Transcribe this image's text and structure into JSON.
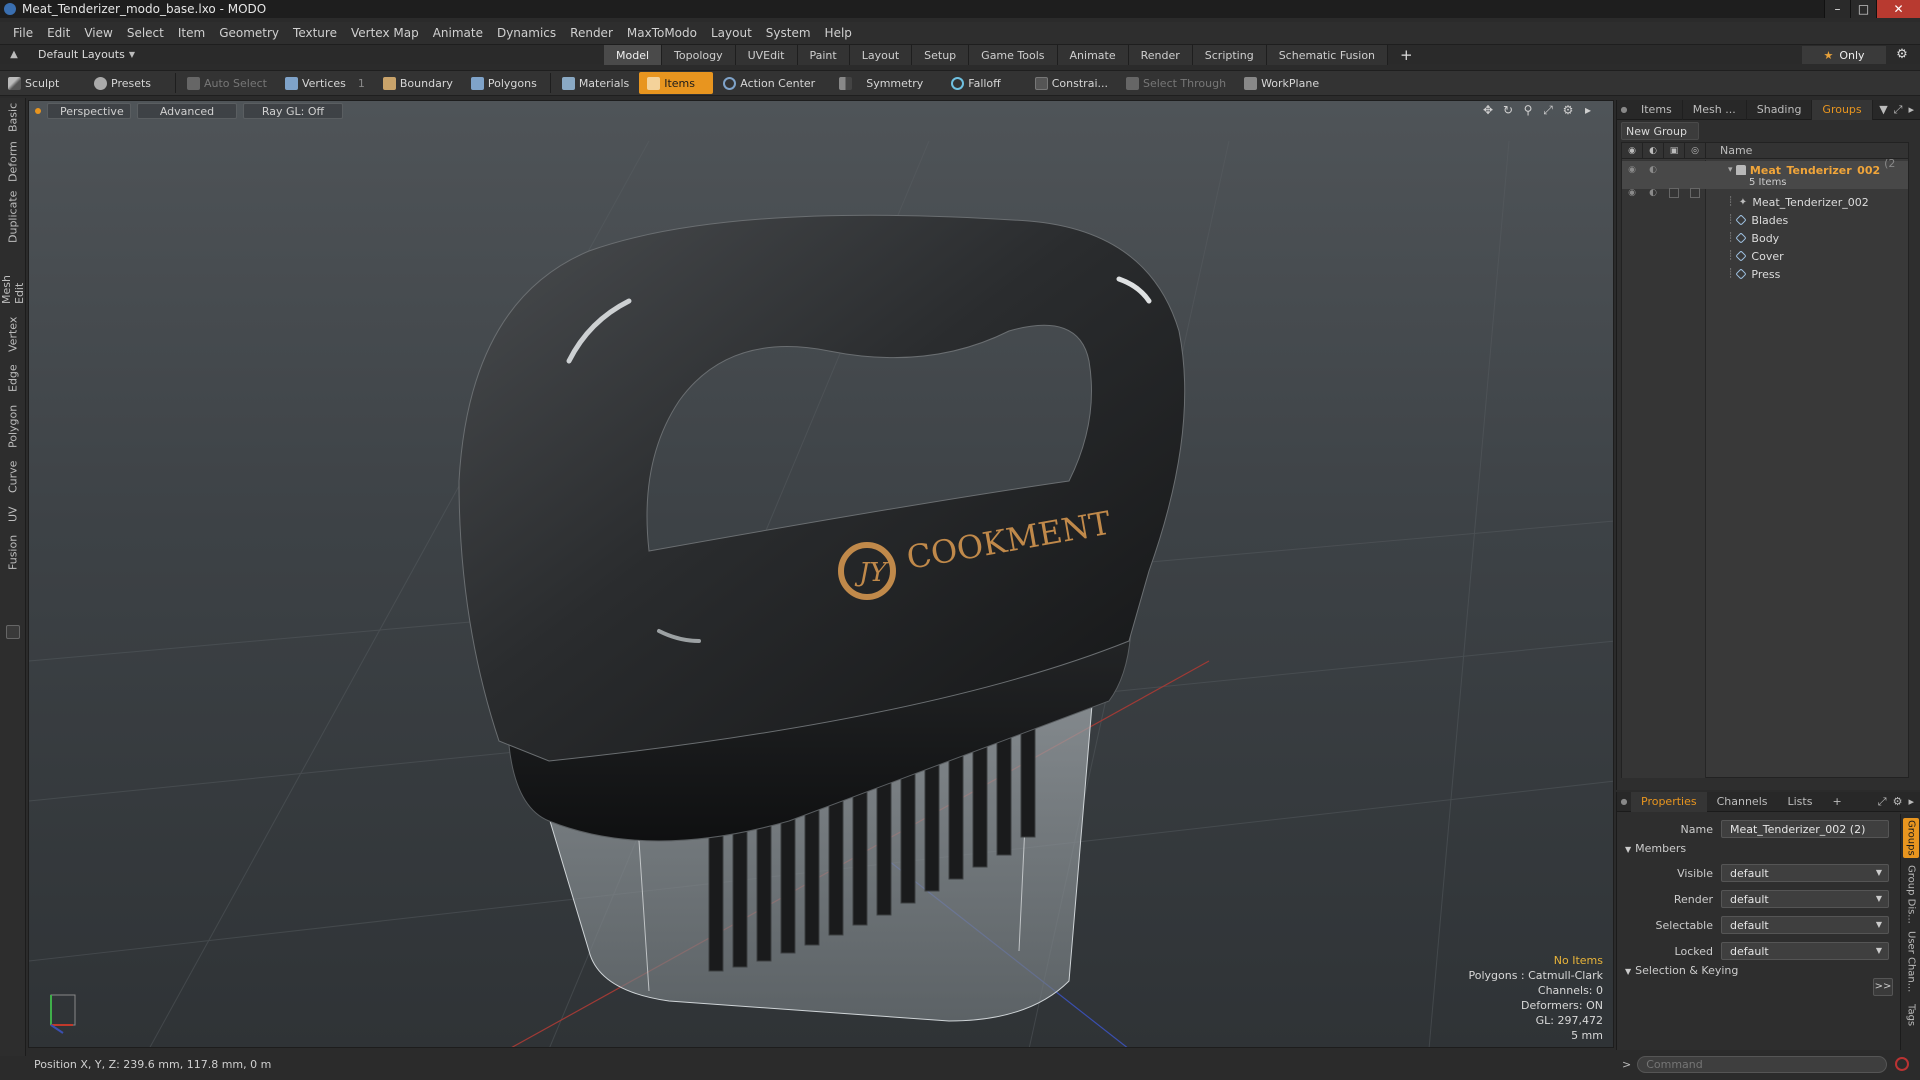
{
  "window": {
    "title": "Meat_Tenderizer_modo_base.lxo - MODO"
  },
  "menu": [
    "File",
    "Edit",
    "View",
    "Select",
    "Item",
    "Geometry",
    "Texture",
    "Vertex Map",
    "Animate",
    "Dynamics",
    "Render",
    "MaxToModo",
    "Layout",
    "System",
    "Help"
  ],
  "layout": {
    "current": "Default Layouts",
    "tabs": [
      "Model",
      "Topology",
      "UVEdit",
      "Paint",
      "Layout",
      "Setup",
      "Game Tools",
      "Animate",
      "Render",
      "Scripting",
      "Schematic Fusion"
    ],
    "active_tab": "Model",
    "only_label": "Only"
  },
  "toolbar": {
    "sculpt": "Sculpt",
    "presets": "Presets",
    "auto_select": "Auto Select",
    "vertices": "Vertices",
    "vertices_count": "1",
    "boundary": "Boundary",
    "polygons": "Polygons",
    "materials": "Materials",
    "items": "Items",
    "action_center": "Action Center",
    "symmetry": "Symmetry",
    "falloff": "Falloff",
    "constrain": "Constrai...",
    "select_through": "Select Through",
    "workplane": "WorkPlane"
  },
  "left_tabs": [
    "Basic",
    "Deform",
    "Duplicate",
    "Mesh Edit",
    "Vertex",
    "Edge",
    "Polygon",
    "Curve",
    "UV",
    "Fusion"
  ],
  "viewport": {
    "view": "Perspective",
    "mode": "Advanced",
    "raygl": "Ray GL: Off",
    "logo_text": "COOKMENT",
    "logo_mark": "JY",
    "info": {
      "no_items": "No Items",
      "polygons": "Polygons : Catmull-Clark",
      "channels": "Channels: 0",
      "deformers": "Deformers: ON",
      "gl": "GL: 297,472",
      "scale": "5 mm"
    }
  },
  "status": {
    "position": "Position X, Y, Z:  239.6 mm, 117.8 mm, 0 m"
  },
  "right_panel": {
    "tabs": [
      "Items",
      "Mesh ...",
      "Shading",
      "Groups"
    ],
    "active_tab": "Groups",
    "new_group": "New Group",
    "name_header": "Name",
    "group": {
      "name": "Meat_Tenderizer_002",
      "count_suffix": "(2 ...",
      "items_label": "5 Items"
    },
    "members": [
      "Meat_Tenderizer_002",
      "Blades",
      "Body",
      "Cover",
      "Press"
    ]
  },
  "properties": {
    "tabs": [
      "Properties",
      "Channels",
      "Lists"
    ],
    "active_tab": "Properties",
    "name_label": "Name",
    "name_value": "Meat_Tenderizer_002 (2)",
    "members_section": "Members",
    "fields": [
      {
        "label": "Visible",
        "value": "default"
      },
      {
        "label": "Render",
        "value": "default"
      },
      {
        "label": "Selectable",
        "value": "default"
      },
      {
        "label": "Locked",
        "value": "default"
      }
    ],
    "selection_section": "Selection & Keying",
    "side_tabs": [
      "Groups",
      "Group Dis...",
      "User Chan...",
      "Tags"
    ]
  },
  "command": {
    "placeholder": "Command"
  }
}
